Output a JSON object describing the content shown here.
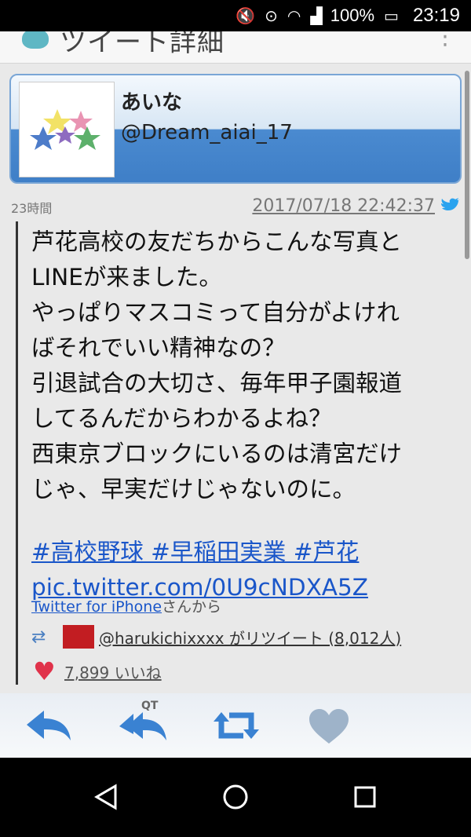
{
  "status_bar": {
    "battery": "100%",
    "time": "23:19",
    "icons": [
      "mute-icon",
      "voicemail-icon",
      "wifi-icon",
      "signal-icon",
      "battery-icon"
    ]
  },
  "header": {
    "title": "ツイート詳細"
  },
  "profile": {
    "name": "あいな",
    "handle": "@Dream_aiai_17"
  },
  "tweet": {
    "age": "23時間",
    "timestamp": "2017/07/18 22:42:37",
    "lines": [
      "芦花高校の友だちからこんな写真と",
      "LINEが来ました。",
      "やっぱりマスコミって自分がよけれ",
      "ばそれでいい精神なの？",
      "引退試合の大切さ、毎年甲子園報道",
      "してるんだからわかるよね？",
      "西東京ブロックにいるのは清宮だけ",
      "じゃ、早実だけじゃないのに。"
    ],
    "hashtags": "#高校野球 #早稲田実業 #芦花",
    "pic_link": "pic.twitter.com/0U9cNDXA5Z",
    "source_app": "Twitter for iPhone",
    "source_suffix": "さんから",
    "retweet_text": "@harukichixxxx がリツイート (8,012人)",
    "likes_text": "7,899 いいね"
  },
  "actions": {
    "qt_label": "QT"
  },
  "colors": {
    "link": "#1a56c9",
    "header_blue": "#3f7fc7",
    "heart": "#e0324a",
    "action_blue": "#3a82d2"
  }
}
